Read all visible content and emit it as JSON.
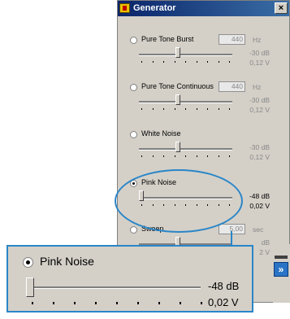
{
  "window": {
    "title": "Generator",
    "close_glyph": "×"
  },
  "sections": [
    {
      "label": "Pure Tone Burst",
      "value": "440",
      "unit": "Hz",
      "db": "-30 dB",
      "voltage": "0,12 V",
      "selected": false,
      "level": 0.4
    },
    {
      "label": "Pure Tone Continuous",
      "value": "440",
      "unit": "Hz",
      "db": "-30 dB",
      "voltage": "0,12 V",
      "selected": false,
      "level": 0.4
    },
    {
      "label": "White Noise",
      "db": "-30 dB",
      "voltage": "0,12 V",
      "selected": false,
      "level": 0.4
    },
    {
      "label": "Pink Noise",
      "db": "-48 dB",
      "voltage": "0,02 V",
      "selected": true,
      "level": 0.0
    },
    {
      "label": "Sweep",
      "value": "5,00",
      "unit": "sec",
      "db": "dB",
      "voltage": "2 V",
      "selected": false,
      "level": 0.4
    }
  ],
  "zoom": {
    "label": "Pink Noise",
    "db": "-48 dB",
    "voltage": "0,02 V",
    "level": 0.0
  },
  "right_panel": {
    "button_glyph": "»"
  },
  "colors": {
    "titlebar": "#0a246a",
    "highlight": "#2a86c8",
    "face": "#d4d0c8"
  }
}
